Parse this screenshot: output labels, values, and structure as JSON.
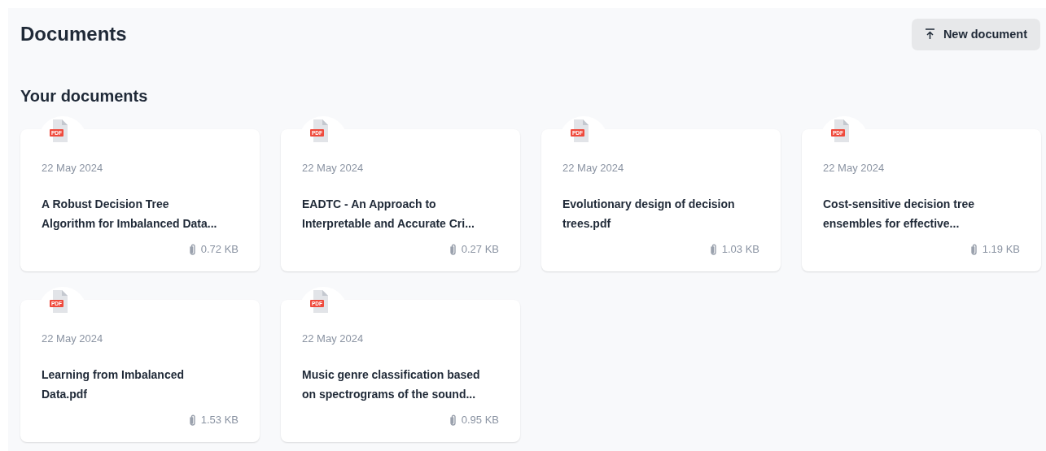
{
  "header": {
    "title": "Documents",
    "new_button": "New document"
  },
  "section": {
    "title": "Your documents"
  },
  "documents": [
    {
      "file_type": "PDF",
      "date": "22 May 2024",
      "name": "A Robust Decision Tree Algorithm for Imbalanced Data...",
      "size": "0.72 KB"
    },
    {
      "file_type": "PDF",
      "date": "22 May 2024",
      "name": "EADTC - An Approach to Interpretable and Accurate Cri...",
      "size": "0.27 KB"
    },
    {
      "file_type": "PDF",
      "date": "22 May 2024",
      "name": "Evolutionary design of decision trees.pdf",
      "size": "1.03 KB"
    },
    {
      "file_type": "PDF",
      "date": "22 May 2024",
      "name": "Cost-sensitive decision tree ensembles for effective...",
      "size": "1.19 KB"
    },
    {
      "file_type": "PDF",
      "date": "22 May 2024",
      "name": "Learning from Imbalanced Data.pdf",
      "size": "1.53 KB"
    },
    {
      "file_type": "PDF",
      "date": "22 May 2024",
      "name": "Music genre classification based on spectrograms of the sound...",
      "size": "0.95 KB"
    }
  ]
}
